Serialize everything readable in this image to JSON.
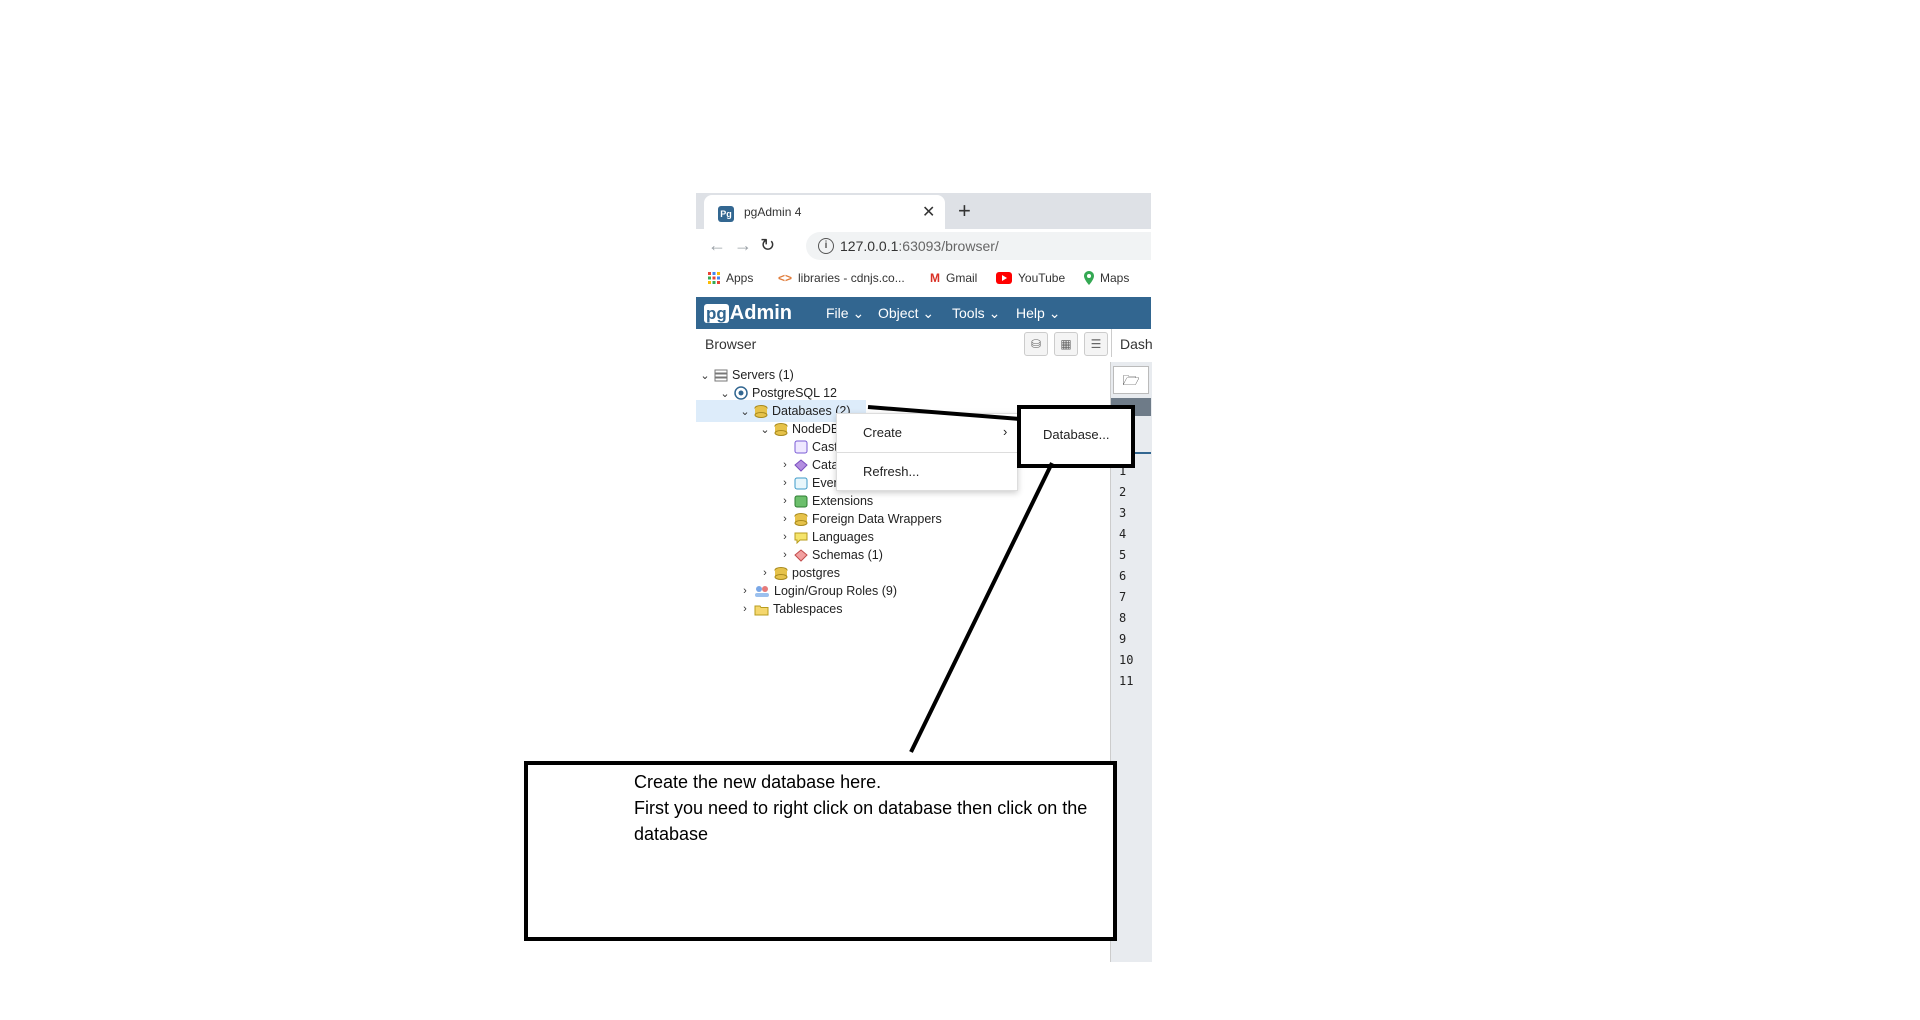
{
  "browser": {
    "tab_title": "pgAdmin 4",
    "tab_favicon": "Pg",
    "close_glyph": "✕",
    "newtab_glyph": "+",
    "url_host": "127.0.0.1",
    "url_rest": ":63093/browser/",
    "bookmarks": [
      "Apps",
      "libraries - cdnjs.co...",
      "Gmail",
      "YouTube",
      "Maps"
    ]
  },
  "pgadmin": {
    "logo_pg": "pg",
    "logo_rest": "Admin",
    "menus": [
      "File",
      "Object",
      "Tools",
      "Help"
    ],
    "panel_title": "Browser",
    "dash_tab": "Dash"
  },
  "tree": {
    "servers": "Servers (1)",
    "server": "PostgreSQL 12",
    "databases": "Databases (2)",
    "node_db": "NodeDB",
    "casts": "Casts",
    "catalogs": "Catalogs",
    "event_triggers": "Event Triggers",
    "extensions": "Extensions",
    "fdw": "Foreign Data Wrappers",
    "languages": "Languages",
    "schemas": "Schemas (1)",
    "postgres": "postgres",
    "login_roles": "Login/Group Roles (9)",
    "tablespaces": "Tablespaces"
  },
  "context_menu": {
    "create": "Create",
    "refresh": "Refresh...",
    "submenu_database": "Database..."
  },
  "line_numbers": [
    "1",
    "2",
    "3",
    "4",
    "5",
    "6",
    "7",
    "8",
    "9",
    "10",
    "11"
  ],
  "annotation": {
    "line1": "Create the new database here.",
    "line2": "First you need to right click on database then click on the database"
  },
  "colors": {
    "pgadmin_header": "#326690",
    "selection": "#ddecfa"
  }
}
